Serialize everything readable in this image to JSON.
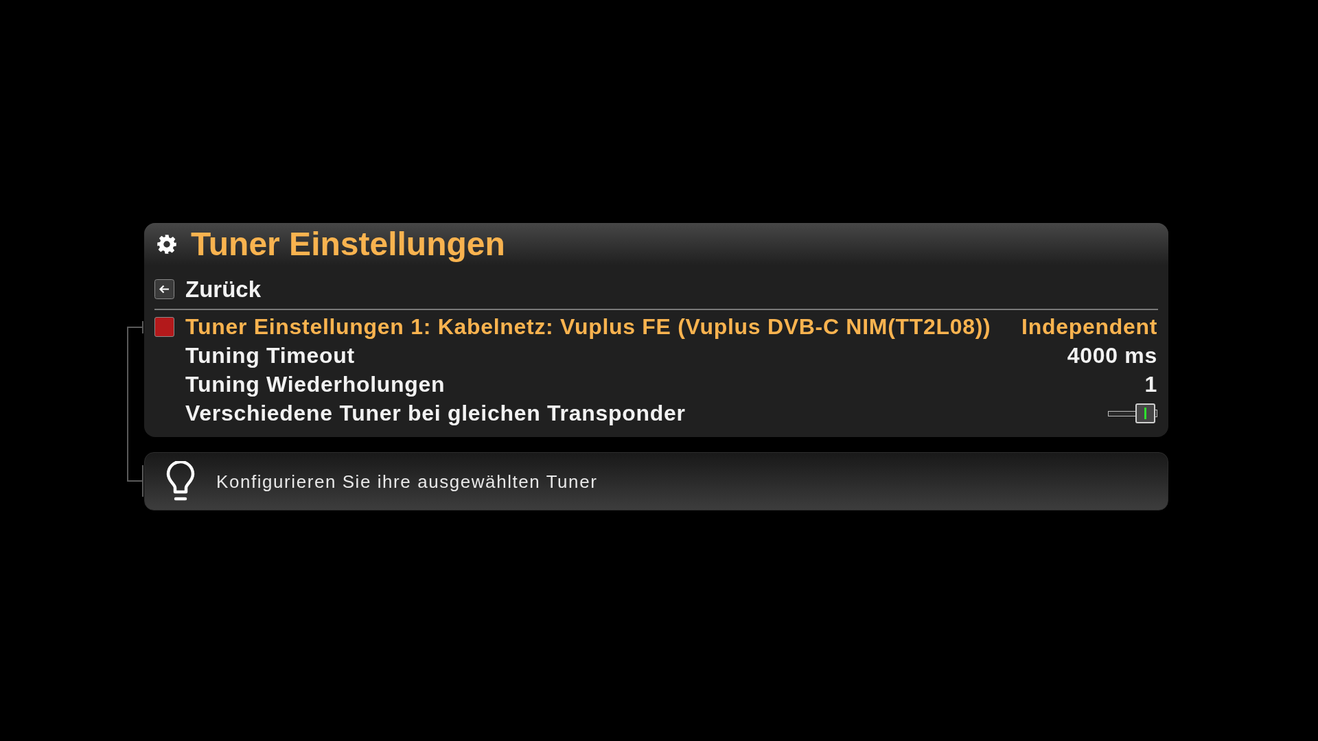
{
  "window": {
    "title": "Tuner Einstellungen"
  },
  "back": {
    "label": "Zurück"
  },
  "settings": [
    {
      "kind": "text",
      "label": "Tuner Einstellungen 1: Kabelnetz: Vuplus FE (Vuplus DVB-C NIM(TT2L08))",
      "value": "Independent",
      "selected": true
    },
    {
      "kind": "text",
      "label": "Tuning Timeout",
      "value": "4000 ms",
      "selected": false
    },
    {
      "kind": "text",
      "label": "Tuning Wiederholungen",
      "value": "1",
      "selected": false
    },
    {
      "kind": "toggle",
      "label": "Verschiedene Tuner bei gleichen Transponder",
      "on": true,
      "selected": false
    }
  ],
  "hint": {
    "text": "Konfigurieren Sie ihre ausgewählten Tuner"
  }
}
